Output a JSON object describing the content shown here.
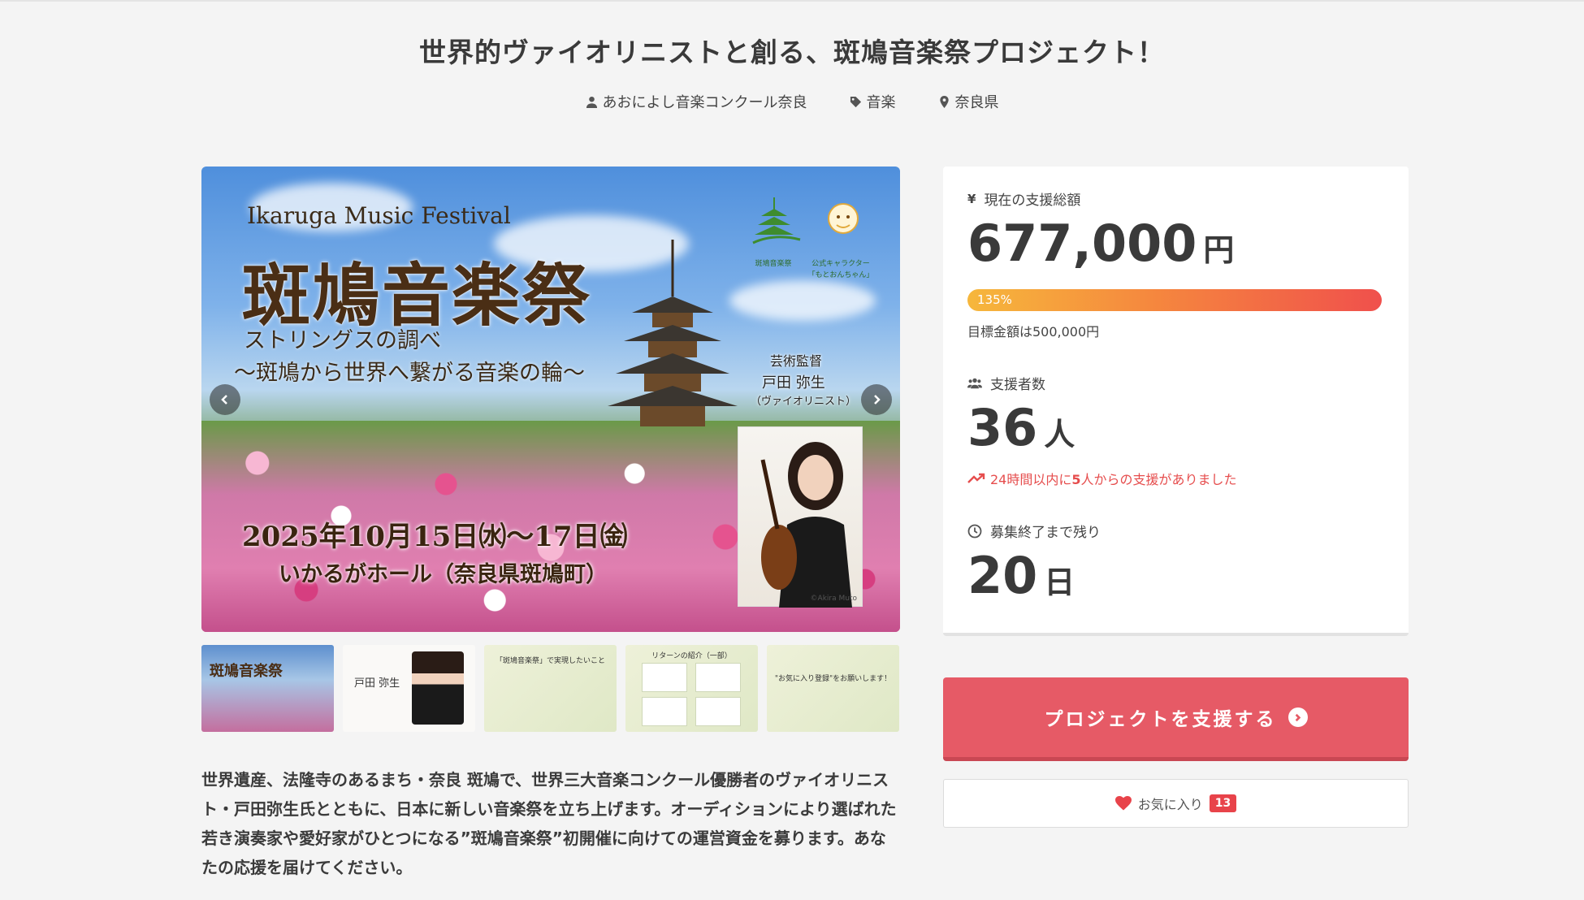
{
  "project": {
    "title": "世界的ヴァイオリニストと創る、斑鳩音楽祭プロジェクト！",
    "owner": "あおによし音楽コンクール奈良",
    "category": "音楽",
    "location": "奈良県"
  },
  "hero": {
    "title_en": "Ikaruga Music Festival",
    "title_jp": "斑鳩音楽祭",
    "subtitle_1": "ストリングスの調べ",
    "subtitle_2": "〜斑鳩から世界へ繋がる音楽の輪〜",
    "date": "2025年10月15日㈬〜17日㈮",
    "venue": "いかるがホール（奈良県斑鳩町）",
    "director_role": "芸術監督",
    "director_name": "戸田 弥生",
    "director_note": "（ヴァイオリニスト）",
    "logo_caption_1": "斑鳩音楽祭",
    "logo_caption_2": "公式キャラクター",
    "logo_caption_3": "「もとおんちゃん」",
    "photo_credit": "©Akira Muto"
  },
  "thumbnails": [
    {
      "caption": "斑鳩音楽祭"
    },
    {
      "caption": "戸田 弥生"
    },
    {
      "caption": "「斑鳩音楽祭」で実現したいこと"
    },
    {
      "caption": "リターンの紹介（一部）"
    },
    {
      "caption": "\"お気に入り登録\"をお願いします！"
    }
  ],
  "description": "世界遺産、法隆寺のあるまち・奈良 斑鳩で、世界三大音楽コンクール優勝者のヴァイオリニスト・戸田弥生氏とともに、日本に新しい音楽祭を立ち上げます。オーディションにより選ばれた若き演奏家や愛好家がひとつになる”斑鳩音楽祭”初開催に向けての運営資金を募ります。あなたの応援を届けてください。",
  "stats": {
    "amount_label": "現在の支援総額",
    "amount": "677,000",
    "amount_unit": "円",
    "progress_percent": 135,
    "progress_label": "135%",
    "goal": "目標金額は500,000円",
    "supporters_label": "支援者数",
    "supporters": "36",
    "supporters_unit": "人",
    "trend_prefix": "24時間以内に",
    "trend_count": "5",
    "trend_suffix": "人からの支援がありました",
    "remaining_label": "募集終了まで残り",
    "remaining": "20",
    "remaining_unit": "日"
  },
  "actions": {
    "support_label": "プロジェクトを支援する",
    "favorite_label": "お気に入り",
    "favorite_count": "13"
  },
  "colors": {
    "accent": "#e65a66",
    "heart": "#e8434a",
    "trend": "#e64d4d"
  },
  "icons": {
    "owner": "user-icon",
    "category": "tag-icon",
    "location": "map-pin-icon",
    "amount": "yen-icon",
    "supporters": "users-icon",
    "trend": "trending-up-icon",
    "remaining": "clock-icon",
    "support": "chevron-right-circle-icon",
    "favorite": "heart-icon"
  }
}
